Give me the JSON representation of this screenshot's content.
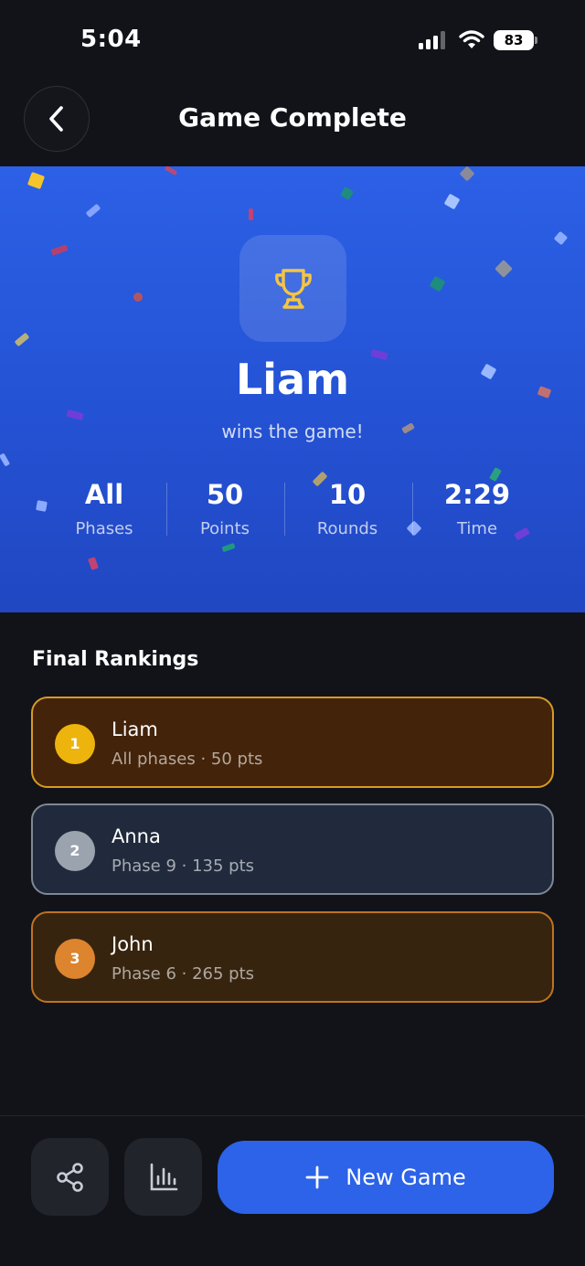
{
  "status_bar": {
    "time": "5:04",
    "battery": "83",
    "icons": [
      "cellular-signal-icon",
      "wifi-icon",
      "battery-icon"
    ]
  },
  "header": {
    "title": "Game Complete",
    "back_icon": "chevron-left-icon"
  },
  "hero": {
    "icon": "trophy-icon",
    "winner": "Liam",
    "subtitle": "wins the game!",
    "stats": [
      {
        "value": "All",
        "label": "Phases"
      },
      {
        "value": "50",
        "label": "Points"
      },
      {
        "value": "10",
        "label": "Rounds"
      },
      {
        "value": "2:29",
        "label": "Time"
      }
    ]
  },
  "rankings": {
    "title": "Final Rankings",
    "items": [
      {
        "rank": "1",
        "name": "Liam",
        "detail": "All phases · 50 pts"
      },
      {
        "rank": "2",
        "name": "Anna",
        "detail": "Phase 9 · 135 pts"
      },
      {
        "rank": "3",
        "name": "John",
        "detail": "Phase 6 · 265 pts"
      }
    ]
  },
  "footer": {
    "share_icon": "share-icon",
    "stats_icon": "bar-chart-icon",
    "new_game_icon": "plus-icon",
    "new_game_label": "New Game"
  },
  "colors": {
    "background": "#121319",
    "hero_blue": "#2452d4",
    "primary_button": "#2c63e8",
    "gold": "#edb40e",
    "silver": "#9aa3ae",
    "bronze": "#dd842e",
    "trophy": "#f5c542"
  }
}
